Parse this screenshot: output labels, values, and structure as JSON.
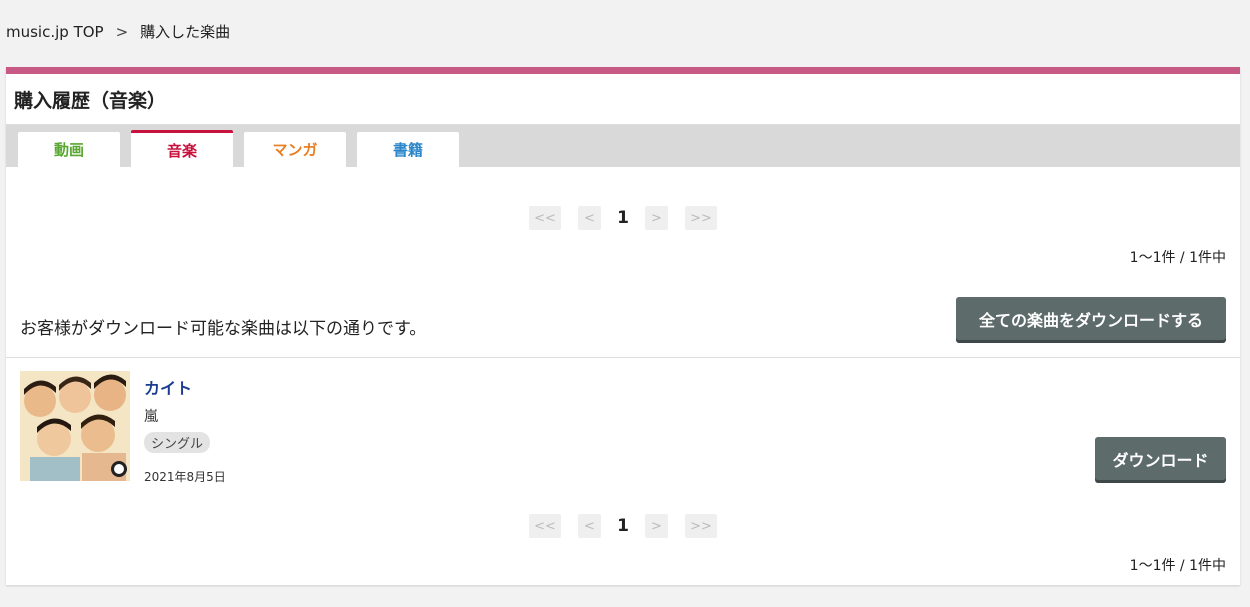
{
  "breadcrumb": {
    "home": "music.jp TOP",
    "separator": ">",
    "current": "購入した楽曲"
  },
  "header": {
    "title": "購入履歴（音楽）"
  },
  "tabs": [
    {
      "label": "動画",
      "color": "#5aa832"
    },
    {
      "label": "音楽",
      "color": "#c8123e",
      "active": true
    },
    {
      "label": "マンガ",
      "color": "#e67e22"
    },
    {
      "label": "書籍",
      "color": "#2a86c9"
    }
  ],
  "pager": {
    "first": "<<",
    "prev": "<",
    "current_page": "1",
    "next": ">",
    "last": ">>",
    "count_text": "1〜1件 /  1件中"
  },
  "notice": "お客様がダウンロード可能な楽曲は以下の通りです。",
  "download_all_label": "全ての楽曲をダウンロードする",
  "items": [
    {
      "title": "カイト",
      "artist": "嵐",
      "type": "シングル",
      "date": "2021年8月5日",
      "download_label": "ダウンロード"
    }
  ],
  "colors": {
    "accent": "#c75a85",
    "active_tab": "#c8123e",
    "button": "#5e6b6b",
    "title_link": "#1b3d8f"
  }
}
